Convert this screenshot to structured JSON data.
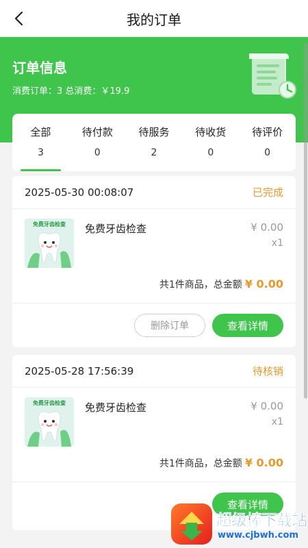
{
  "header": {
    "title": "我的订单"
  },
  "banner": {
    "title": "订单信息",
    "summary": "消费订单：3  总消费：￥19.9"
  },
  "tabs": [
    {
      "label": "全部",
      "count": "3",
      "active": true
    },
    {
      "label": "待付款",
      "count": "0"
    },
    {
      "label": "待服务",
      "count": "2"
    },
    {
      "label": "待收货",
      "count": "0"
    },
    {
      "label": "待评价",
      "count": "0"
    }
  ],
  "orders": [
    {
      "time": "2025-05-30 00:08:07",
      "status": "已完成",
      "item_name": "免费牙齿检查",
      "thumb_caption": "免费牙齿检查",
      "price": "¥ 0.00",
      "qty": "x1",
      "summary_label": "共1件商品，总金额",
      "total": "¥ 0.00",
      "delete_label": "删除订单",
      "detail_label": "查看详情"
    },
    {
      "time": "2025-05-28 17:56:39",
      "status": "待核销",
      "item_name": "免费牙齿检查",
      "thumb_caption": "免费牙齿检查",
      "price": "¥ 0.00",
      "qty": "x1",
      "summary_label": "共1件商品，总金额",
      "total": "¥ 0.00",
      "detail_label": "查看详情"
    }
  ],
  "watermark": {
    "name": "超级棒下载站",
    "url": "www.cjbwh.com"
  },
  "colors": {
    "accent": "#3fc44c",
    "status": "#e69a2c"
  }
}
